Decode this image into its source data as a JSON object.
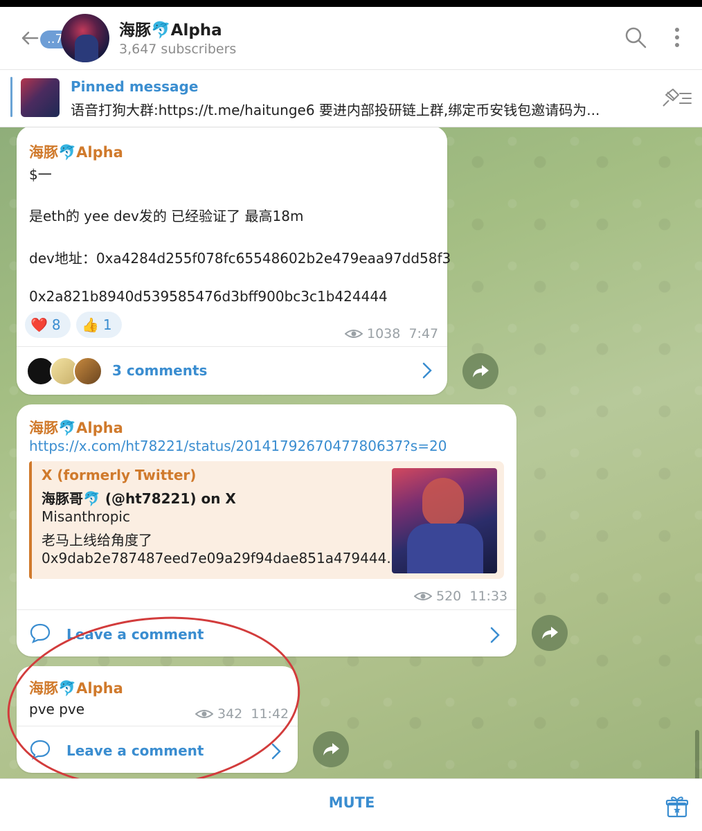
{
  "header": {
    "unread_count": "..79",
    "title": "海豚🐬Alpha",
    "subscribers": "3,647 subscribers"
  },
  "pinned": {
    "label": "Pinned message",
    "text": "语音打狗大群:https://t.me/haitunge6   要进内部投研链上群,绑定币安钱包邀请码为..."
  },
  "messages": [
    {
      "author": "海豚🐬Alpha",
      "lines": [
        "$一",
        "是eth的 yee dev发的 已经验证了 最高18m",
        "dev地址：0xa4284d255f078fc65548602b2e479eaa97dd58f3",
        "0x2a821b8940d539585476d3bff900bc3c1b424444"
      ],
      "reactions": [
        {
          "emoji": "❤️",
          "count": "8"
        },
        {
          "emoji": "👍",
          "count": "1"
        }
      ],
      "views": "1038",
      "time": "7:47",
      "comments_label": "3 comments"
    },
    {
      "author": "海豚🐬Alpha",
      "link": "https://x.com/ht78221/status/2014179267047780637?s=20",
      "preview": {
        "site": "X (formerly Twitter)",
        "title": "海豚哥🐬 (@ht78221) on X",
        "line1": "Misanthropic",
        "line2": "老马上线给角度了",
        "line3": "0x9dab2e787487eed7e09a29f94dae851a479444..."
      },
      "views": "520",
      "time": "11:33",
      "comments_label": "Leave a comment"
    },
    {
      "author": "海豚🐬Alpha",
      "text": "pve pve",
      "views": "342",
      "time": "11:42",
      "comments_label": "Leave a comment"
    }
  ],
  "bottom": {
    "mute_label": "MUTE"
  },
  "colors": {
    "accent": "#3a8dd0",
    "author": "#d07a2c",
    "annotation": "#d23c3c",
    "unread_badge": "#6e9ed6"
  },
  "icons": [
    "back-arrow-icon",
    "search-icon",
    "more-vertical-icon",
    "pinned-list-icon",
    "eye-icon",
    "comment-icon",
    "chevron-right-icon",
    "share-icon",
    "gift-icon"
  ]
}
